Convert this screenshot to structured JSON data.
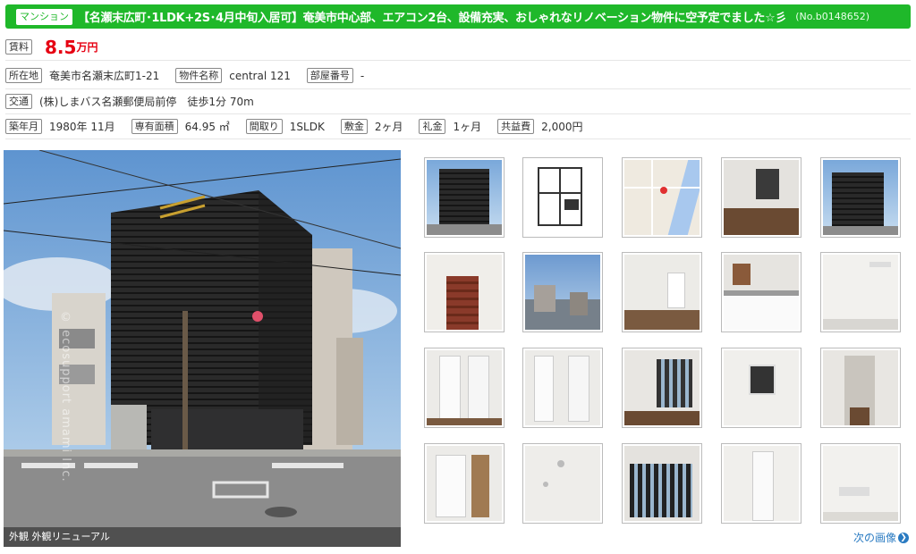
{
  "header": {
    "type_badge": "マンション",
    "title": "【名瀬末広町･1LDK+2S･4月中旬入居可】奄美市中心部、エアコン2台、設備充実、おしゃれなリノベーション物件に空予定でました☆彡",
    "number": "(No.b0148652)"
  },
  "rent": {
    "label": "賃料",
    "value": "8.5",
    "unit": "万円"
  },
  "location": {
    "address_label": "所在地",
    "address": "奄美市名瀬末広町1-21",
    "name_label": "物件名称",
    "name": "central 121",
    "room_label": "部屋番号",
    "room": "-"
  },
  "transport": {
    "label": "交通",
    "value": "(株)しまバス名瀬郵便局前停　徒歩1分 70m"
  },
  "details": [
    {
      "label": "築年月",
      "value": "1980年 11月"
    },
    {
      "label": "専有面積",
      "value": "64.95 ㎡"
    },
    {
      "label": "間取り",
      "value": "1SLDK"
    },
    {
      "label": "敷金",
      "value": "2ヶ月"
    },
    {
      "label": "礼金",
      "value": "1ヶ月"
    },
    {
      "label": "共益費",
      "value": "2,000円"
    }
  ],
  "main_photo": {
    "caption": "外観 外観リニューアル",
    "watermark": "© ecosupport amami Inc."
  },
  "next_link": "次の画像",
  "colors": {
    "header_green": "#1fb82a",
    "price_red": "#e60012",
    "link_blue": "#2a7bc2"
  },
  "thumbnails": [
    "exterior",
    "floor-plan",
    "map",
    "living-room",
    "exterior",
    "stairs",
    "view",
    "living-room",
    "kitchen",
    "room",
    "closet",
    "closet",
    "window-room",
    "window-room",
    "hallway",
    "closet",
    "ceiling",
    "window-room",
    "door",
    "room"
  ]
}
